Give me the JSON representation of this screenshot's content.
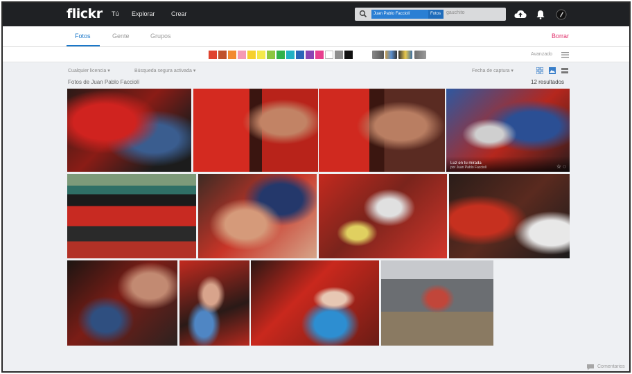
{
  "nav": {
    "logo": "flickr",
    "links": [
      "Tú",
      "Explorar",
      "Crear"
    ],
    "search_chip_primary": "Juan Pablo Facciolí",
    "search_chip_secondary": "Fotos",
    "search_placeholder": "gauchito"
  },
  "tabs": {
    "photos": "Fotos",
    "people": "Gente",
    "groups": "Grupos",
    "share": "Borrar"
  },
  "colors": {
    "swatches": [
      "#e0432e",
      "#c0522c",
      "#f28a2f",
      "#f59ab4",
      "#f6d02d",
      "#f4e94a",
      "#8cc63f",
      "#31b24b",
      "#22b1c4",
      "#2a65b8",
      "#8a44b3",
      "#e83f8e",
      "#ffffff",
      "#8e8e8e",
      "#111111"
    ],
    "brand": "#1a77c9",
    "accent": "#e0306b"
  },
  "advanced": {
    "label": "Avanzado"
  },
  "filters": {
    "license": "Cualquier licencia ▾",
    "safesearch": "Búsqueda segura activada ▾",
    "sort": "Fecha de captura ▾"
  },
  "results": {
    "title": "Fotos de Juan Pablo Facciolí",
    "count": "12 resultados"
  },
  "photos": {
    "p4_title": "Luz en tu mirada",
    "p4_sub": "por Juan Pablo Facciolí",
    "p4_icons": "☆ ◌"
  },
  "footer": {
    "comments": "Comentarios"
  }
}
